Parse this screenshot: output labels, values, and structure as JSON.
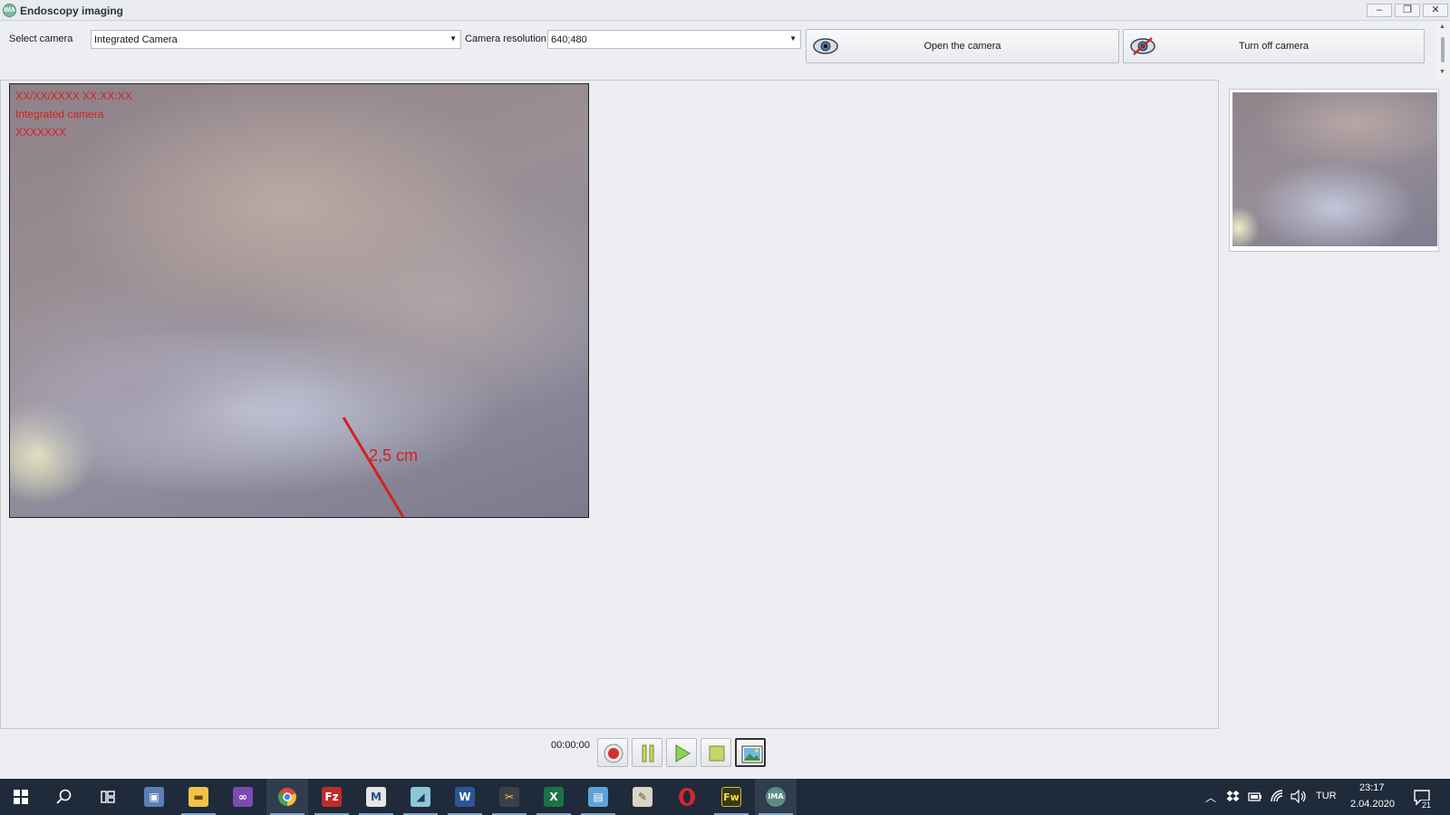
{
  "window": {
    "title": "Endoscopy imaging",
    "app_icon_text": "IMA",
    "controls": {
      "minimize": "–",
      "restore": "❐",
      "close": "✕"
    }
  },
  "toolbar": {
    "select_camera_label": "Select camera",
    "camera_value": "Integrated Camera",
    "resolution_label": "Camera resolution",
    "resolution_value": "640;480",
    "open_button": "Open the camera",
    "off_button": "Turn off camera",
    "open_icon": "eye-icon",
    "off_icon": "eye-crossed-icon"
  },
  "video": {
    "overlay": [
      "XX/XX/XXXX XX:XX:XX",
      "Integrated camera",
      "XXXXXXX"
    ],
    "measurement": "2,5 cm",
    "measure_color": "#d42020"
  },
  "player": {
    "time": "00:00:00",
    "buttons": [
      "record-icon",
      "pause-icon",
      "play-icon",
      "stop-icon",
      "snapshot-icon"
    ]
  },
  "taskbar": {
    "apps": [
      {
        "name": "start-icon"
      },
      {
        "name": "search-icon"
      },
      {
        "name": "task-view-icon"
      },
      {
        "name": "app-icon-1"
      },
      {
        "name": "file-explorer-icon"
      },
      {
        "name": "visual-studio-icon"
      },
      {
        "name": "chrome-icon"
      },
      {
        "name": "filezilla-icon"
      },
      {
        "name": "app-icon-2"
      },
      {
        "name": "app-icon-3"
      },
      {
        "name": "word-icon"
      },
      {
        "name": "app-icon-4"
      },
      {
        "name": "excel-icon"
      },
      {
        "name": "app-icon-5"
      },
      {
        "name": "app-icon-6"
      },
      {
        "name": "opera-icon"
      },
      {
        "name": "fireworks-icon"
      },
      {
        "name": "endoscopy-app-icon"
      }
    ],
    "language": "TUR",
    "time": "23:17",
    "date": "2.04.2020",
    "notifications": "21",
    "accent": "#1f2b3a"
  }
}
